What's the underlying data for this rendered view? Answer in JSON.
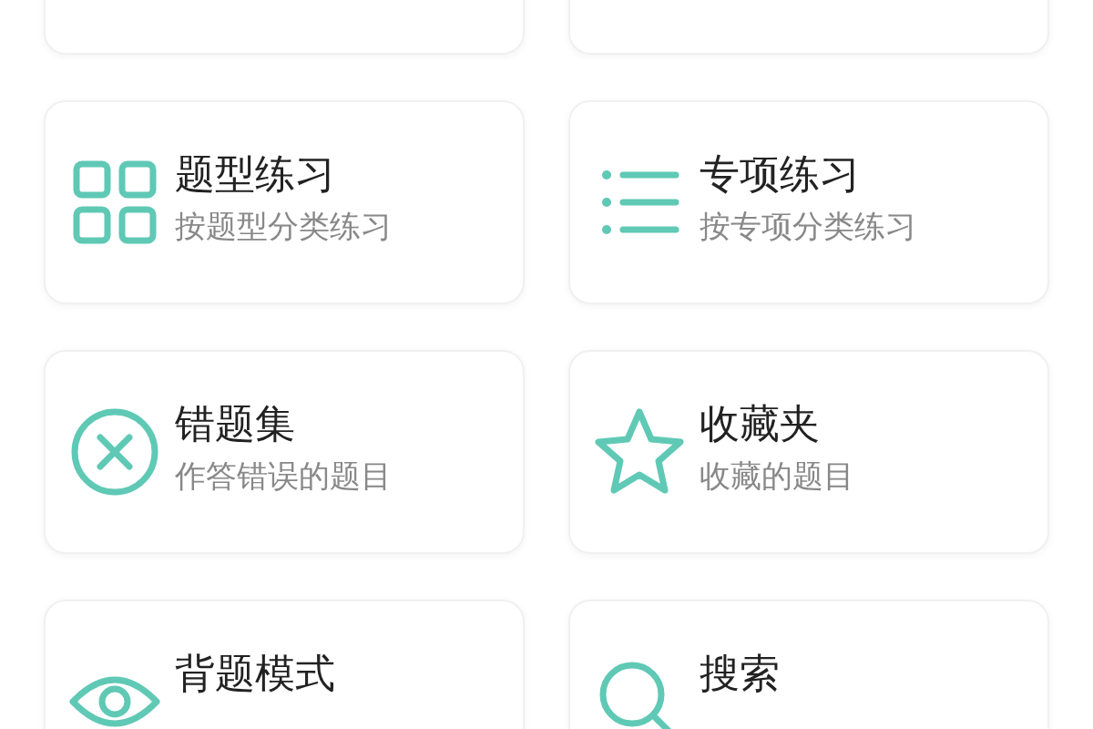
{
  "cards": [
    {
      "kind": "cut"
    },
    {
      "kind": "cut"
    },
    {
      "kind": "grid",
      "title": "题型练习",
      "subtitle": "按题型分类练习"
    },
    {
      "kind": "list",
      "title": "专项练习",
      "subtitle": "按专项分类练习"
    },
    {
      "kind": "cross",
      "title": "错题集",
      "subtitle": "作答错误的题目"
    },
    {
      "kind": "star",
      "title": "收藏夹",
      "subtitle": "收藏的题目"
    },
    {
      "kind": "eye",
      "title": "背题模式"
    },
    {
      "kind": "search",
      "title": "搜索"
    }
  ]
}
